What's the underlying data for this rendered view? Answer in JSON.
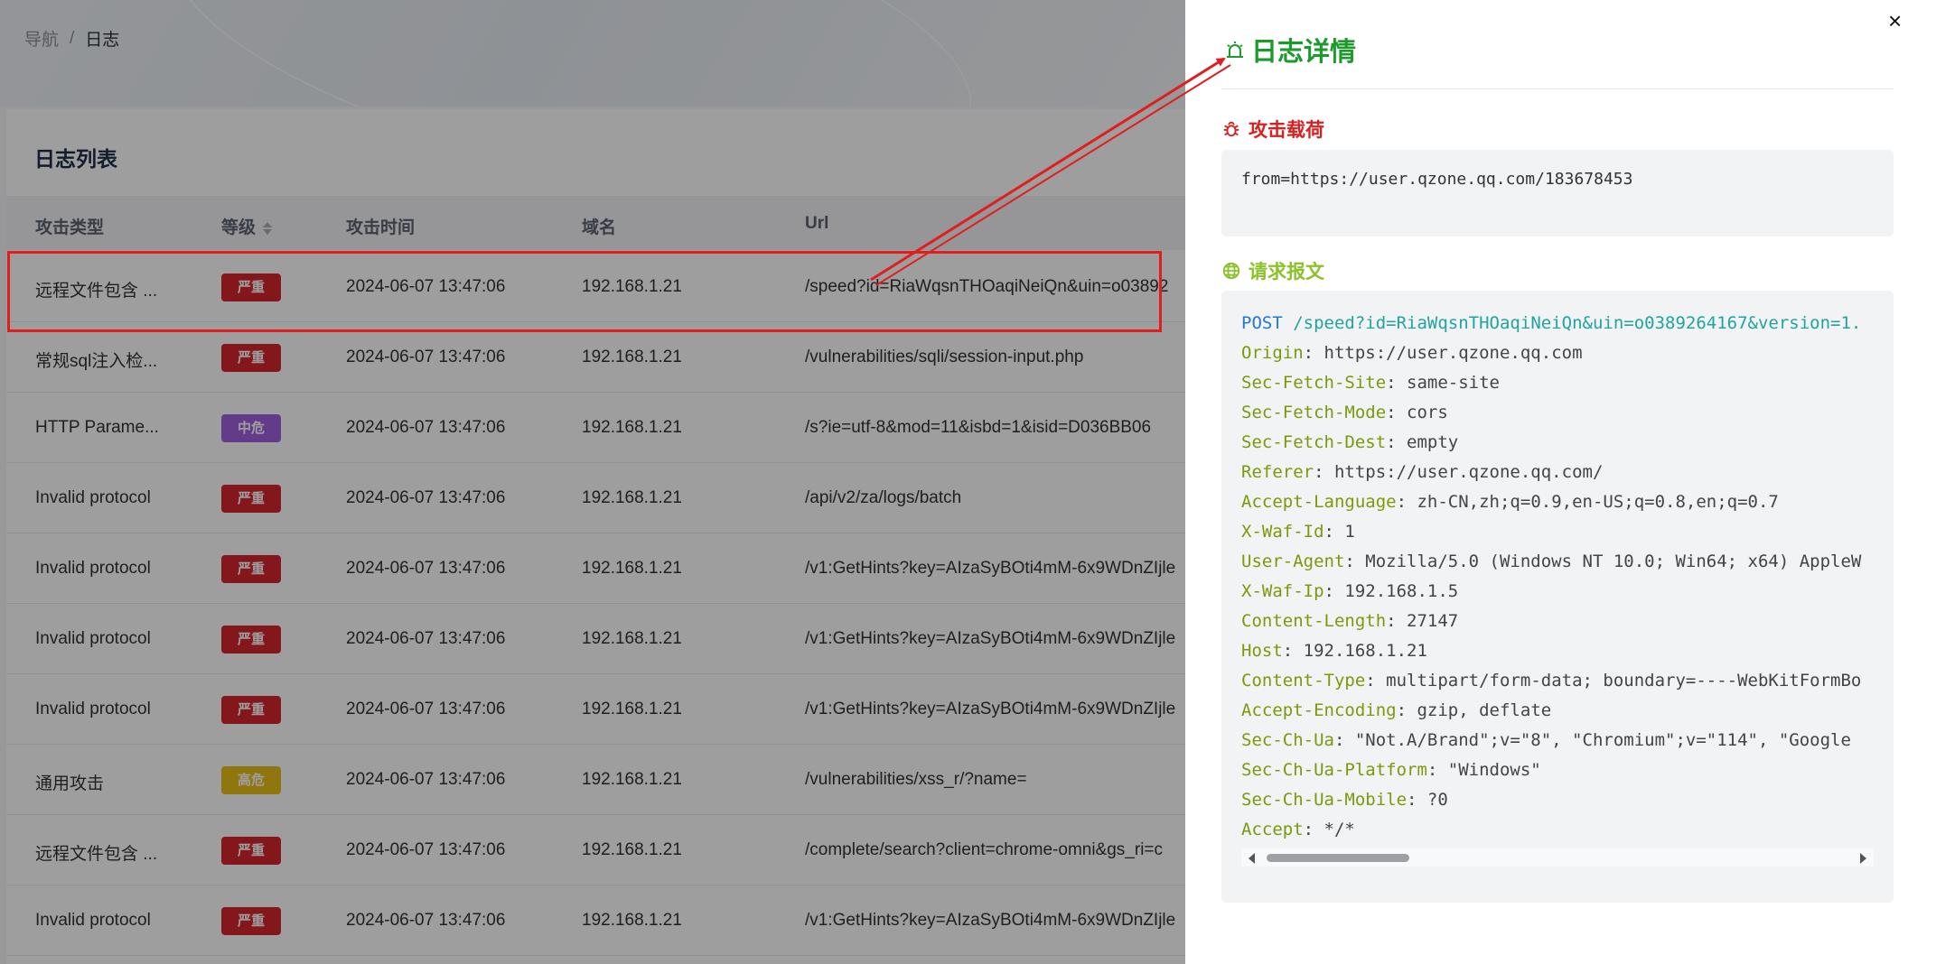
{
  "breadcrumb": {
    "nav": "导航",
    "sep": "/",
    "current": "日志"
  },
  "card": {
    "title": "日志列表"
  },
  "table": {
    "headers": {
      "type": "攻击类型",
      "level": "等级",
      "time": "攻击时间",
      "domain": "域名",
      "url": "Url"
    },
    "rows": [
      {
        "type": "远程文件包含 ...",
        "level": "严重",
        "level_color": "red",
        "time": "2024-06-07 13:47:06",
        "domain": "192.168.1.21",
        "url": "/speed?id=RiaWqsnTHOaqiNeiQn&uin=o03892"
      },
      {
        "type": "常规sql注入检...",
        "level": "严重",
        "level_color": "red",
        "time": "2024-06-07 13:47:06",
        "domain": "192.168.1.21",
        "url": "/vulnerabilities/sqli/session-input.php"
      },
      {
        "type": "HTTP Parame...",
        "level": "中危",
        "level_color": "purple",
        "time": "2024-06-07 13:47:06",
        "domain": "192.168.1.21",
        "url": "/s?ie=utf-8&mod=11&isbd=1&isid=D036BB06"
      },
      {
        "type": "Invalid protocol",
        "level": "严重",
        "level_color": "red",
        "time": "2024-06-07 13:47:06",
        "domain": "192.168.1.21",
        "url": "/api/v2/za/logs/batch"
      },
      {
        "type": "Invalid protocol",
        "level": "严重",
        "level_color": "red",
        "time": "2024-06-07 13:47:06",
        "domain": "192.168.1.21",
        "url": "/v1:GetHints?key=AIzaSyBOti4mM-6x9WDnZIjle"
      },
      {
        "type": "Invalid protocol",
        "level": "严重",
        "level_color": "red",
        "time": "2024-06-07 13:47:06",
        "domain": "192.168.1.21",
        "url": "/v1:GetHints?key=AIzaSyBOti4mM-6x9WDnZIjle"
      },
      {
        "type": "Invalid protocol",
        "level": "严重",
        "level_color": "red",
        "time": "2024-06-07 13:47:06",
        "domain": "192.168.1.21",
        "url": "/v1:GetHints?key=AIzaSyBOti4mM-6x9WDnZIjle"
      },
      {
        "type": "通用攻击",
        "level": "高危",
        "level_color": "yellow",
        "time": "2024-06-07 13:47:06",
        "domain": "192.168.1.21",
        "url": "/vulnerabilities/xss_r/?name="
      },
      {
        "type": "远程文件包含 ...",
        "level": "严重",
        "level_color": "red",
        "time": "2024-06-07 13:47:06",
        "domain": "192.168.1.21",
        "url": "/complete/search?client=chrome-omni&gs_ri=c"
      },
      {
        "type": "Invalid protocol",
        "level": "严重",
        "level_color": "red",
        "time": "2024-06-07 13:47:06",
        "domain": "192.168.1.21",
        "url": "/v1:GetHints?key=AIzaSyBOti4mM-6x9WDnZIjle"
      }
    ]
  },
  "drawer": {
    "close": "×",
    "title": "日志详情",
    "payload_title": "攻击载荷",
    "payload": "from=https://user.qzone.qq.com/183678453",
    "request_title": "请求报文",
    "request_line": {
      "method": "POST",
      "path": "/speed?id=RiaWqsnTHOaqiNeiQn&uin=o0389264167&version=1."
    },
    "headers": [
      {
        "k": "Origin",
        "v": "https://user.qzone.qq.com"
      },
      {
        "k": "Sec-Fetch-Site",
        "v": "same-site"
      },
      {
        "k": "Sec-Fetch-Mode",
        "v": "cors"
      },
      {
        "k": "Sec-Fetch-Dest",
        "v": "empty"
      },
      {
        "k": "Referer",
        "v": "https://user.qzone.qq.com/"
      },
      {
        "k": "Accept-Language",
        "v": "zh-CN,zh;q=0.9,en-US;q=0.8,en;q=0.7"
      },
      {
        "k": "X-Waf-Id",
        "v": "1"
      },
      {
        "k": "User-Agent",
        "v": "Mozilla/5.0 (Windows NT 10.0; Win64; x64) AppleW"
      },
      {
        "k": "X-Waf-Ip",
        "v": "192.168.1.5"
      },
      {
        "k": "Content-Length",
        "v": "27147"
      },
      {
        "k": "Host",
        "v": "192.168.1.21"
      },
      {
        "k": "Content-Type",
        "v": "multipart/form-data; boundary=----WebKitFormBo"
      },
      {
        "k": "Accept-Encoding",
        "v": "gzip, deflate"
      },
      {
        "k": "Sec-Ch-Ua",
        "v": "\"Not.A/Brand\";v=\"8\", \"Chromium\";v=\"114\", \"Google"
      },
      {
        "k": "Sec-Ch-Ua-Platform",
        "v": "\"Windows\""
      },
      {
        "k": "Sec-Ch-Ua-Mobile",
        "v": "?0"
      },
      {
        "k": "Accept",
        "v": "*/*"
      }
    ]
  },
  "colors": {
    "title_green": "#1c9a2c",
    "payload_red": "#d9201f",
    "request_green": "#8bc22a",
    "badge_red": "#d3262e",
    "badge_purple": "#a15fe0",
    "badge_yellow": "#e8c016",
    "annotation_red": "#e21d1d"
  },
  "icons": {
    "title": "alarm-icon",
    "payload": "bug-icon",
    "request": "globe-icon",
    "close": "close-icon"
  }
}
